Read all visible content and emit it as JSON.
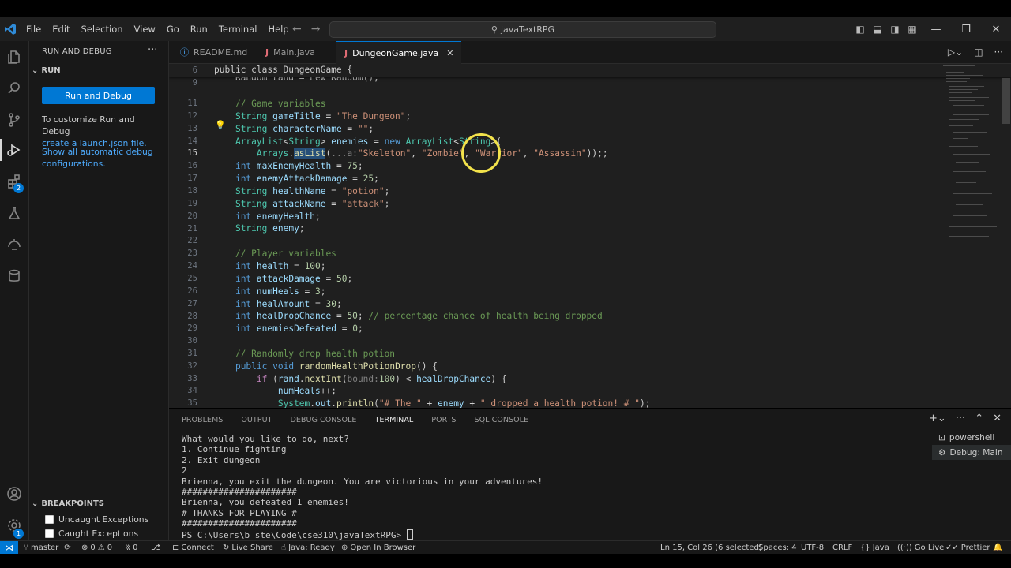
{
  "menu": [
    "File",
    "Edit",
    "Selection",
    "View",
    "Go",
    "Run",
    "Terminal",
    "Help"
  ],
  "command_center": "javaTextRPG",
  "sidebar": {
    "title": "RUN AND DEBUG",
    "section_run": "RUN",
    "run_button": "Run and Debug",
    "customize_text": "To customize Run and Debug",
    "launch_link": "create a launch.json file.",
    "auto_debug_link": "Show all automatic debug configurations.",
    "section_breakpoints": "BREAKPOINTS",
    "breakpoints": [
      "Uncaught Exceptions",
      "Caught Exceptions"
    ]
  },
  "activity_badges": {
    "extensions": "2",
    "settings": "1"
  },
  "tabs": [
    {
      "label": "README.md",
      "icon": "info-icon"
    },
    {
      "label": "Main.java",
      "icon": "java-icon"
    },
    {
      "label": "DungeonGame.java",
      "icon": "java-icon"
    }
  ],
  "editor": {
    "sticky_line_number": "6",
    "sticky_code": "public class DungeonGame {",
    "partial_line_number": "9",
    "partial_line": "    Random rand = new Random();",
    "line_numbers": [
      "11",
      "12",
      "13",
      "14",
      "15",
      "16",
      "17",
      "18",
      "19",
      "20",
      "21",
      "22",
      "23",
      "24",
      "25",
      "26",
      "27",
      "28",
      "29",
      "30",
      "31",
      "32",
      "33",
      "34",
      "35"
    ],
    "current_line": "15"
  },
  "panel": {
    "tabs": [
      "PROBLEMS",
      "OUTPUT",
      "DEBUG CONSOLE",
      "TERMINAL",
      "PORTS",
      "SQL CONSOLE"
    ],
    "active_tab": "TERMINAL",
    "terminal_lines": [
      "What would you like to do, next?",
      "1. Continue fighting",
      "2. Exit dungeon",
      "2",
      "Brienna, you exit the dungeon. You are victorious in your adventures!",
      "######################",
      "Brienna, you defeated 1 enemies!",
      "# THANKS FOR PLAYING #",
      "######################",
      "PS C:\\Users\\b_ste\\Code\\cse310\\javaTextRPG> "
    ],
    "terminals": [
      "powershell",
      "Debug: Main"
    ]
  },
  "status": {
    "branch": "master",
    "errors": "0",
    "warnings": "0",
    "ports": "0",
    "connect": "Connect",
    "live_share": "Live Share",
    "java_status": "Java: Ready",
    "open_browser": "Open In Browser",
    "position": "Ln 15, Col 26 (6 selected)",
    "spaces": "Spaces: 4",
    "encoding": "UTF-8",
    "eol": "CRLF",
    "language": "Java",
    "go_live": "Go Live",
    "prettier": "Prettier"
  }
}
